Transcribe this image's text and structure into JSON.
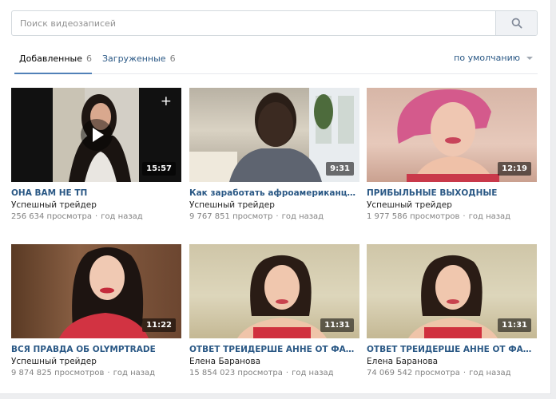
{
  "search": {
    "placeholder": "Поиск видеозаписей",
    "value": ""
  },
  "tabs": [
    {
      "label": "Добавленные",
      "count": "6"
    },
    {
      "label": "Загруженные",
      "count": "6"
    }
  ],
  "sort": {
    "label": "по умолчанию"
  },
  "videos": [
    {
      "title": "ОНА ВАМ НЕ ТП",
      "author": "Успешный трейдер",
      "views": "256 634 просмотра",
      "age": "год назад",
      "duration": "15:57"
    },
    {
      "title": "Как заработать афроамериканцу в Рос…",
      "author": "Успешный трейдер",
      "views": "9 767 851 просмотр",
      "age": "год назад",
      "duration": "9:31"
    },
    {
      "title": "ПРИБЫЛЬНЫЕ ВЫХОДНЫЕ",
      "author": "Успешный трейдер",
      "views": "1 977 586 просмотров",
      "age": "год назад",
      "duration": "12:19"
    },
    {
      "title": "ВСЯ ПРАВДА ОБ OLYMPTRADE",
      "author": "Успешный трейдер",
      "views": "9 874 825 просмотров",
      "age": "год назад",
      "duration": "11:22"
    },
    {
      "title": "ОТВЕТ ТРЕЙДЕРШЕ АННЕ ОТ ФАНАТКИ",
      "author": "Елена Баранова",
      "views": "15 854 023 просмотра",
      "age": "год назад",
      "duration": "11:31"
    },
    {
      "title": "ОТВЕТ ТРЕЙДЕРШЕ АННЕ ОТ ФАНАТКИ",
      "author": "Елена Баранова",
      "views": "74 069 542 просмотра",
      "age": "год назад",
      "duration": "11:31"
    }
  ],
  "dot": "·",
  "plus_glyph": "+"
}
